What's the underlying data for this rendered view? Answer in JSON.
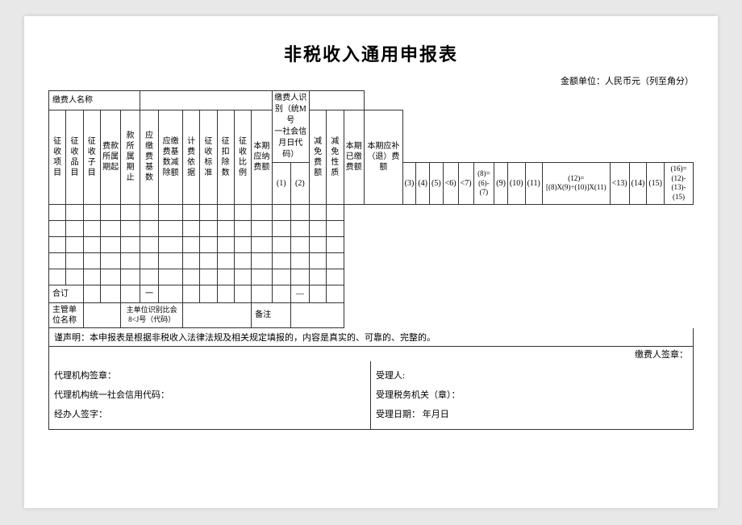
{
  "title": "非税收入通用申报表",
  "currency_note": "金额单位：人民币元（列至角分）",
  "table": {
    "taxpayer_label": "缴费人名称",
    "taxpayer_id_label1": "缴费人识别（统M号",
    "taxpayer_id_label2": "一社会信月日代码）",
    "header_row1": [
      {
        "text": "征收项目",
        "rowspan": 2
      },
      {
        "text": "征收品目",
        "rowspan": 2
      },
      {
        "text": "征收子目",
        "rowspan": 2
      },
      {
        "text": "费款所属期起",
        "rowspan": 2
      },
      {
        "text": "款所属期止",
        "rowspan": 2
      },
      {
        "text": "应缴费基数",
        "rowspan": 2
      },
      {
        "text": "应缴费基数减除额",
        "rowspan": 2
      },
      {
        "text": "计费依据",
        "rowspan": 2
      },
      {
        "text": "征收标准",
        "rowspan": 2
      },
      {
        "text": "征扣除数",
        "rowspan": 2
      },
      {
        "text": "征收比例",
        "rowspan": 2
      },
      {
        "text": "本期应纳费额",
        "rowspan": 2
      },
      {
        "text": "减免费额",
        "rowspan": 2
      },
      {
        "text": "减免性质",
        "rowspan": 2
      },
      {
        "text": "本期已缴费额",
        "rowspan": 2
      },
      {
        "text": "本期应补（退）费额",
        "rowspan": 2
      }
    ],
    "number_row": [
      "(1)",
      "(2)",
      "(3)",
      "(4)",
      "(5)",
      "<6)",
      "<7)",
      "(8) = (6)-(7)",
      "(9)",
      "(10)",
      "(11)",
      "(12)=[(8)X(9)÷(10)]X(11)",
      "<13)",
      "(14)",
      "(15)",
      "(16)=(12)-(13)-(15)"
    ],
    "data_rows": [
      [
        "",
        "",
        "",
        "",
        "",
        "",
        "",
        "",
        "",
        "",
        "",
        "",
        "",
        "",
        "",
        ""
      ],
      [
        "",
        "",
        "",
        "",
        "",
        "",
        "",
        "",
        "",
        "",
        "",
        "",
        "",
        "",
        "",
        ""
      ],
      [
        "",
        "",
        "",
        "",
        "",
        "",
        "",
        "",
        "",
        "",
        "",
        "",
        "",
        "",
        "",
        ""
      ],
      [
        "",
        "",
        "",
        "",
        "",
        "",
        "",
        "",
        "",
        "",
        "",
        "",
        "",
        "",
        "",
        ""
      ],
      [
        "",
        "",
        "",
        "",
        "",
        "",
        "",
        "",
        "",
        "",
        "",
        "",
        "",
        "",
        "",
        ""
      ]
    ],
    "subtotal_label": "合订",
    "subtotal_dash1": "一",
    "subtotal_dash2": "—",
    "authority_label": "主管单位名称",
    "authority_id_label": "主单位识别比会8<J号（代码）",
    "remark_label": "备注"
  },
  "declaration": "谨声明：本申报表是根据非税收入法律法规及相关规定填报的，内容是真实的、可靠的、完整的。",
  "taxpayer_sig_label": "缴费人签章：",
  "sig_left": {
    "agency_sig": "代理机构签章：",
    "agency_id": "代理机构统一社会信用代码：",
    "handler_sig": "经办人签字："
  },
  "sig_right": {
    "receiver_label": "受理人:",
    "tax_auth_label": "受理税务机关（章）：",
    "date_label": "受理日期：     年月日"
  }
}
